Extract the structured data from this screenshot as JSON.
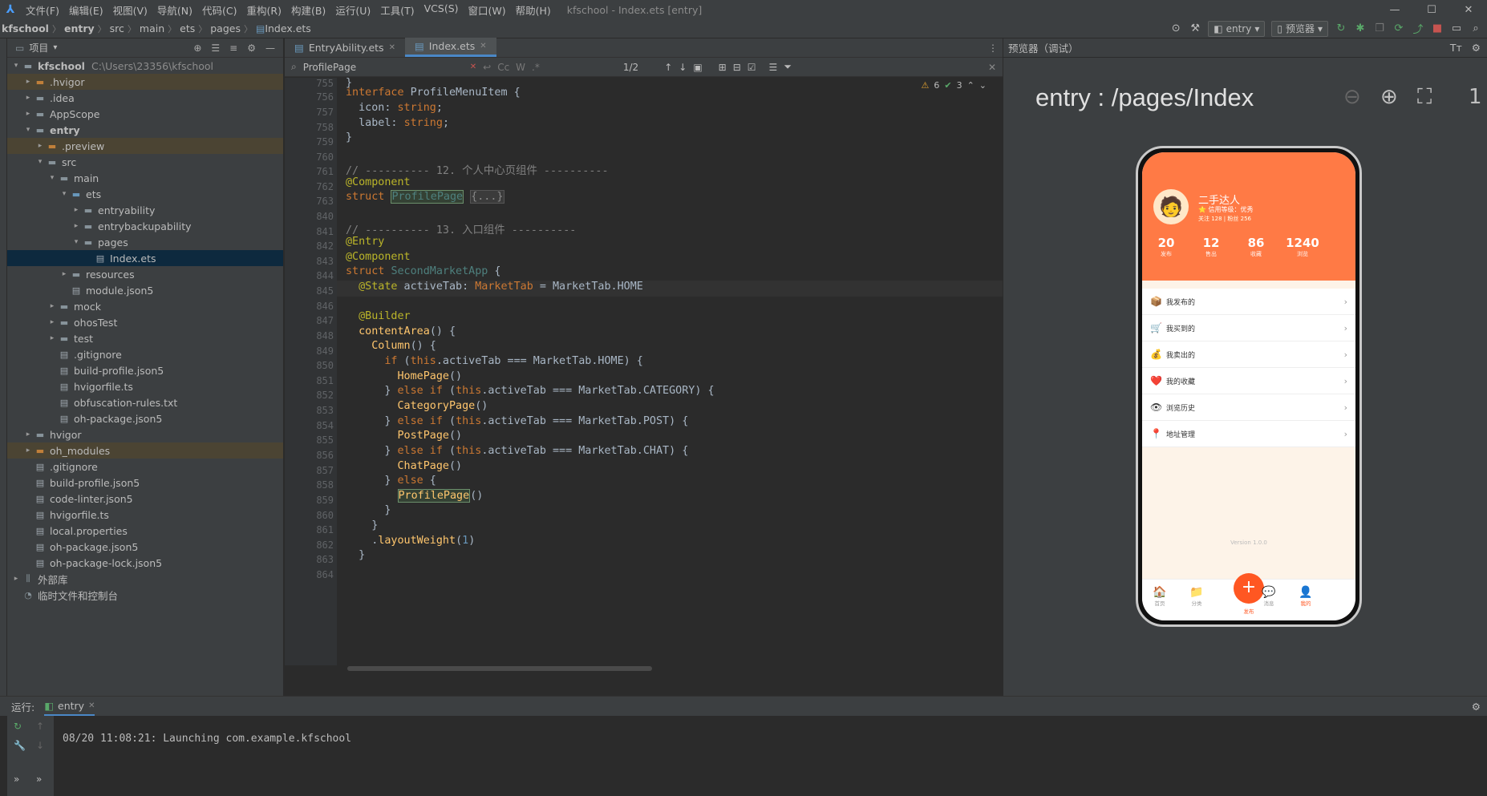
{
  "menu": {
    "items": [
      "文件(F)",
      "编辑(E)",
      "视图(V)",
      "导航(N)",
      "代码(C)",
      "重构(R)",
      "构建(B)",
      "运行(U)",
      "工具(T)",
      "VCS(S)",
      "窗口(W)",
      "帮助(H)"
    ],
    "window_title": "kfschool - Index.ets [entry]"
  },
  "breadcrumb": [
    "kfschool",
    "entry",
    "src",
    "main",
    "ets",
    "pages",
    "Index.ets"
  ],
  "toolbar": {
    "module": "entry",
    "previewer": "预览器"
  },
  "project": {
    "header": "项目",
    "tree": [
      {
        "label": "kfschool",
        "extra": "C:\\Users\\23356\\kfschool",
        "depth": 0,
        "arrow": "▾",
        "kind": "folder",
        "bold": true
      },
      {
        "label": ".hvigor",
        "depth": 1,
        "arrow": "▸",
        "kind": "folder-orange",
        "hl": true
      },
      {
        "label": ".idea",
        "depth": 1,
        "arrow": "▸",
        "kind": "folder"
      },
      {
        "label": "AppScope",
        "depth": 1,
        "arrow": "▸",
        "kind": "folder"
      },
      {
        "label": "entry",
        "depth": 1,
        "arrow": "▾",
        "kind": "folder",
        "bold": true
      },
      {
        "label": ".preview",
        "depth": 2,
        "arrow": "▸",
        "kind": "folder-orange",
        "hl": true
      },
      {
        "label": "src",
        "depth": 2,
        "arrow": "▾",
        "kind": "folder"
      },
      {
        "label": "main",
        "depth": 3,
        "arrow": "▾",
        "kind": "folder"
      },
      {
        "label": "ets",
        "depth": 4,
        "arrow": "▾",
        "kind": "folder-blue"
      },
      {
        "label": "entryability",
        "depth": 5,
        "arrow": "▸",
        "kind": "folder"
      },
      {
        "label": "entrybackupability",
        "depth": 5,
        "arrow": "▸",
        "kind": "folder"
      },
      {
        "label": "pages",
        "depth": 5,
        "arrow": "▾",
        "kind": "folder"
      },
      {
        "label": "Index.ets",
        "depth": 6,
        "arrow": "",
        "kind": "file",
        "sel": true
      },
      {
        "label": "resources",
        "depth": 4,
        "arrow": "▸",
        "kind": "folder"
      },
      {
        "label": "module.json5",
        "depth": 4,
        "arrow": "",
        "kind": "file"
      },
      {
        "label": "mock",
        "depth": 3,
        "arrow": "▸",
        "kind": "folder"
      },
      {
        "label": "ohosTest",
        "depth": 3,
        "arrow": "▸",
        "kind": "folder"
      },
      {
        "label": "test",
        "depth": 3,
        "arrow": "▸",
        "kind": "folder"
      },
      {
        "label": ".gitignore",
        "depth": 3,
        "arrow": "",
        "kind": "file"
      },
      {
        "label": "build-profile.json5",
        "depth": 3,
        "arrow": "",
        "kind": "file"
      },
      {
        "label": "hvigorfile.ts",
        "depth": 3,
        "arrow": "",
        "kind": "file"
      },
      {
        "label": "obfuscation-rules.txt",
        "depth": 3,
        "arrow": "",
        "kind": "file"
      },
      {
        "label": "oh-package.json5",
        "depth": 3,
        "arrow": "",
        "kind": "file"
      },
      {
        "label": "hvigor",
        "depth": 1,
        "arrow": "▸",
        "kind": "folder"
      },
      {
        "label": "oh_modules",
        "depth": 1,
        "arrow": "▸",
        "kind": "folder-orange",
        "hl": true
      },
      {
        "label": ".gitignore",
        "depth": 1,
        "arrow": "",
        "kind": "file"
      },
      {
        "label": "build-profile.json5",
        "depth": 1,
        "arrow": "",
        "kind": "file"
      },
      {
        "label": "code-linter.json5",
        "depth": 1,
        "arrow": "",
        "kind": "file"
      },
      {
        "label": "hvigorfile.ts",
        "depth": 1,
        "arrow": "",
        "kind": "file"
      },
      {
        "label": "local.properties",
        "depth": 1,
        "arrow": "",
        "kind": "file"
      },
      {
        "label": "oh-package.json5",
        "depth": 1,
        "arrow": "",
        "kind": "file"
      },
      {
        "label": "oh-package-lock.json5",
        "depth": 1,
        "arrow": "",
        "kind": "file"
      },
      {
        "label": "外部库",
        "depth": 0,
        "arrow": "▸",
        "kind": "lib"
      },
      {
        "label": "临时文件和控制台",
        "depth": 0,
        "arrow": "",
        "kind": "scratch"
      }
    ]
  },
  "editor": {
    "tabs": [
      {
        "label": "EntryAbility.ets",
        "active": false
      },
      {
        "label": "Index.ets",
        "active": true
      }
    ],
    "search": {
      "value": "ProfilePage",
      "count": "1/2"
    },
    "warnings": "6",
    "ok": "3",
    "line_numbers": [
      "755",
      "756",
      "757",
      "758",
      "759",
      "760",
      "761",
      "762",
      "763",
      "840",
      "841",
      "842",
      "843",
      "844",
      "845",
      "846",
      "847",
      "848",
      "849",
      "850",
      "851",
      "852",
      "853",
      "854",
      "855",
      "856",
      "857",
      "858",
      "859",
      "860",
      "861",
      "862",
      "863",
      "864"
    ]
  },
  "preview": {
    "header": "预览器（调试）",
    "title": "entry : /pages/Index",
    "user": {
      "name": "二手达人",
      "level": "⭐ 信用等级：优秀",
      "follow": "关注 128 | 粉丝 256"
    },
    "stats": [
      {
        "v": "20",
        "l": "发布"
      },
      {
        "v": "12",
        "l": "售出"
      },
      {
        "v": "86",
        "l": "收藏"
      },
      {
        "v": "1240",
        "l": "浏览"
      }
    ],
    "menu": [
      {
        "icon": "📦",
        "label": "我发布的"
      },
      {
        "icon": "🛒",
        "label": "我买到的"
      },
      {
        "icon": "💰",
        "label": "我卖出的"
      },
      {
        "icon": "❤️",
        "label": "我的收藏"
      },
      {
        "icon": "👁",
        "label": "浏览历史"
      },
      {
        "icon": "📍",
        "label": "地址管理"
      }
    ],
    "version": "Version 1.0.0",
    "tabbar": [
      {
        "icon": "🏠",
        "label": "首页"
      },
      {
        "icon": "📁",
        "label": "分类"
      },
      {
        "icon": "💬",
        "label": "消息"
      },
      {
        "icon": "👤",
        "label": "我的"
      }
    ],
    "post_label": "发布"
  },
  "run": {
    "label": "运行:",
    "config": "entry",
    "log": "08/20 11:08:21: Launching com.example.kfschool"
  },
  "colors": {
    "accent": "#ff7a45",
    "selection": "#0d293e",
    "ignored": "#4b4433"
  }
}
